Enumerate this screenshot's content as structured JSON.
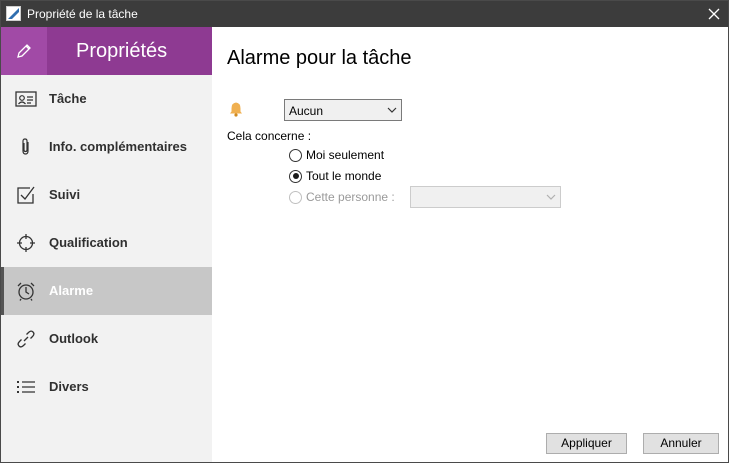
{
  "window": {
    "title": "Propriété de la tâche"
  },
  "sidebar": {
    "header": "Propriétés",
    "items": [
      {
        "label": "Tâche",
        "icon": "id-card-icon"
      },
      {
        "label": "Info. complémentaires",
        "icon": "paperclip-icon"
      },
      {
        "label": "Suivi",
        "icon": "checkbox-icon"
      },
      {
        "label": "Qualification",
        "icon": "crosshair-icon"
      },
      {
        "label": "Alarme",
        "icon": "alarm-clock-icon",
        "active": true
      },
      {
        "label": "Outlook",
        "icon": "link-icon"
      },
      {
        "label": "Divers",
        "icon": "list-icon"
      }
    ]
  },
  "main": {
    "title": "Alarme pour la tâche",
    "alarm_select": "Aucun",
    "concern_label": "Cela concerne :",
    "options": {
      "only_me": "Moi seulement",
      "everyone": "Tout le monde",
      "this_person": "Cette personne :"
    },
    "selected_option": "everyone",
    "person_select": ""
  },
  "buttons": {
    "apply": "Appliquer",
    "cancel": "Annuler"
  },
  "colors": {
    "accent": "#8e3a92",
    "accent_light": "#a14aa6",
    "titlebar": "#3c3c3c",
    "sidebar_bg": "#f2f2f2",
    "active_item": "#c7c7c7",
    "bell": "#f0b050"
  }
}
